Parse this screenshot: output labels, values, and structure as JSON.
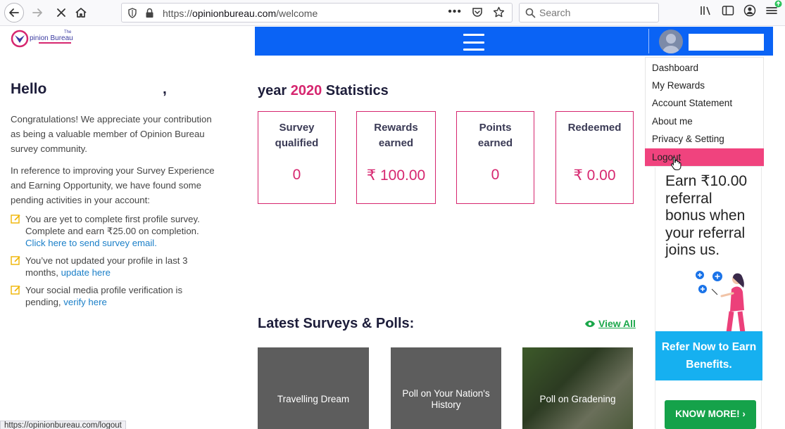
{
  "browser": {
    "url_prefix": "https://",
    "url_host": "opinionbureau.com",
    "url_path": "/welcome",
    "search_placeholder": "Search",
    "status_url": "https://opinionbureau.com/logout"
  },
  "logo": {
    "text": "pinion Bureau",
    "small_text": "The"
  },
  "left": {
    "greeting": "Hello",
    "comma": ",",
    "paragraph1": "Congratulations! We appreciate your contribution as being a valuable member of Opinion Bureau survey community.",
    "paragraph2": "In reference to improving your Survey Experience and Earning Opportunity, we have found some pending activities in your account:",
    "tasks": [
      {
        "text": "You are yet to complete first profile survey. Complete and earn ₹25.00 on completion. ",
        "link": "Click here to send survey email."
      },
      {
        "text": "You’ve not updated your profile in last 3 months, ",
        "link": "update here"
      },
      {
        "text": "Your social media profile verification is pending, ",
        "link": "verify here"
      }
    ]
  },
  "stats": {
    "title_prefix": "year",
    "year": "2020",
    "title_suffix": "Statistics",
    "cards": [
      {
        "label_line1": "Survey",
        "label_line2": "qualified",
        "value": "0"
      },
      {
        "label_line1": "Rewards",
        "label_line2": "earned",
        "value": "₹ 100.00"
      },
      {
        "label_line1": "Points",
        "label_line2": "earned",
        "value": "0"
      },
      {
        "label_line1": "Redeemed",
        "label_line2": "",
        "value": "₹ 0.00"
      }
    ]
  },
  "surveys": {
    "title": "Latest Surveys & Polls:",
    "view_all": "View All",
    "items": [
      {
        "line1": "Travelling Dream",
        "line2": ""
      },
      {
        "line1": "Poll on Your Nation's",
        "line2": "History"
      },
      {
        "line1": "Poll on Gradening",
        "line2": ""
      }
    ]
  },
  "menu": {
    "items": [
      "Dashboard",
      "My Rewards",
      "Account Statement",
      "About me",
      "Privacy & Setting",
      "Logout"
    ]
  },
  "ad": {
    "text_lines": [
      "Earn ₹10.00",
      "referral",
      "bonus when",
      "your referral",
      "joins us."
    ],
    "banner_line1": "Refer Now to Earn",
    "banner_line2": "Benefits.",
    "button": "KNOW MORE! ›"
  },
  "colors": {
    "accent": "#d6266f",
    "topbar": "#0a63f5",
    "menu_active": "#f0437e",
    "green": "#15a24a"
  }
}
